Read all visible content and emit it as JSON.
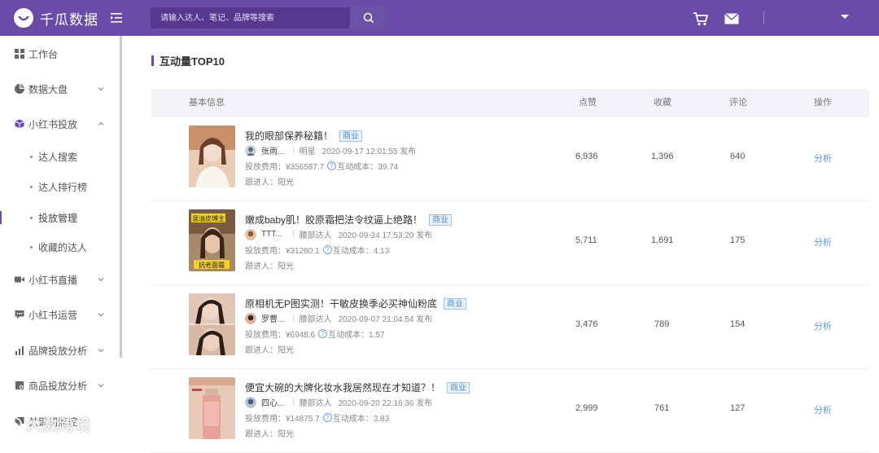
{
  "app": {
    "title": "千瓜数据"
  },
  "search": {
    "placeholder": "请输入达人、笔记、品牌等搜索"
  },
  "sidebar": {
    "items": [
      {
        "label": "工作台",
        "icon": "grid-icon"
      },
      {
        "label": "数据大盘",
        "icon": "pie-chart-icon"
      },
      {
        "label": "小红书投放",
        "icon": "cube-icon"
      },
      {
        "label": "小红书直播",
        "icon": "video-icon"
      },
      {
        "label": "小红书运营",
        "icon": "chat-icon"
      },
      {
        "label": "品牌投放分析",
        "icon": "bar-chart-icon"
      },
      {
        "label": "商品投放分析",
        "icon": "store-icon"
      },
      {
        "label": "关键词监控",
        "icon": "monitor-icon"
      }
    ],
    "sub_items": [
      {
        "label": "达人搜索"
      },
      {
        "label": "达人排行榜"
      },
      {
        "label": "投放管理"
      },
      {
        "label": "收藏的达人"
      }
    ]
  },
  "section": {
    "title": "互动量TOP10"
  },
  "table": {
    "columns": [
      "基本信息",
      "点赞",
      "收藏",
      "评论",
      "操作"
    ],
    "rows": [
      {
        "title": "我的眼部保养秘籍！",
        "tag": "商业",
        "author": "张雨...",
        "category": "明星",
        "time": "2020-09-17 12:01:55 发布",
        "cost": "投放费用：¥356587.7",
        "interact_cost": "互动成本：39.74",
        "follow": "跟进人：阳光",
        "likes": "6,936",
        "collects": "1,396",
        "comments": "640",
        "action": "分析"
      },
      {
        "title": "嫩成baby肌！胶原霜把法令纹逼上绝路！",
        "tag": "商业",
        "author": "TTT...",
        "category": "腰部达人",
        "time": "2020-09-24 17:53:20 发布",
        "cost": "投放费用：¥31280.1",
        "interact_cost": "互动成本：4.13",
        "follow": "跟进人：阳光",
        "likes": "5,711",
        "collects": "1,691",
        "comments": "175",
        "action": "分析",
        "thumb_text_top": "混油皮博主",
        "thumb_text_bottom": "抗老面霜"
      },
      {
        "title": "原相机无P图实测！干敏皮换季必买神仙粉底",
        "tag": "商业",
        "author": "罗瞢...",
        "category": "腰部达人",
        "time": "2020-09-07 21:04:54 发布",
        "cost": "投放费用：¥6948.6",
        "interact_cost": "互动成本：1.57",
        "follow": "跟进人：阳光",
        "likes": "3,476",
        "collects": "789",
        "comments": "154",
        "action": "分析"
      },
      {
        "title": "便宜大碗的大牌化妆水我居然现在才知道？！",
        "tag": "商业",
        "author": "四心...",
        "category": "腰部达人",
        "time": "2020-09-20 22:16:36 发布",
        "cost": "投放费用：¥14875.7",
        "interact_cost": "互动成本：3.83",
        "follow": "跟进人：阳光",
        "likes": "2,999",
        "collects": "761",
        "comments": "127",
        "action": "分析"
      }
    ]
  },
  "watermark": {
    "text": "大数跨境"
  },
  "colors": {
    "brand": "#6a4ca8",
    "link": "#5b9be0",
    "tag": "#4b8ad6"
  }
}
